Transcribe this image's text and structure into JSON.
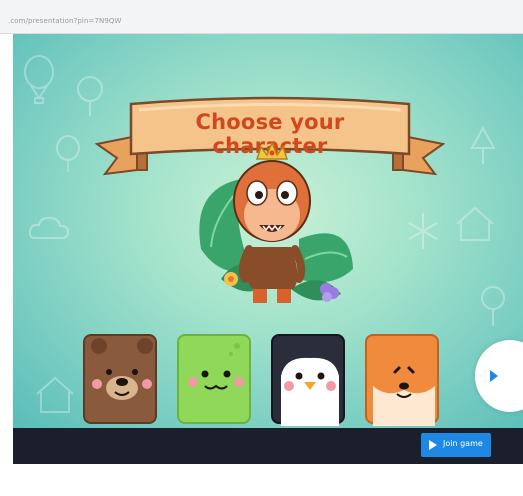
{
  "browser": {
    "url": ".com/presentation?pin=7N9QW"
  },
  "game": {
    "title": "Choose your character",
    "characters": [
      {
        "name": "bear",
        "color": "#8a5a3c"
      },
      {
        "name": "frog",
        "color": "#8fd85a"
      },
      {
        "name": "penguin",
        "color": "#2b2d3a"
      },
      {
        "name": "fox",
        "color": "#f08a3c"
      }
    ],
    "selected_character": "monkey-king",
    "next_icon": "chevron-right-icon"
  },
  "footer": {
    "join_label": "Join game",
    "join_icon": "play-icon",
    "accent": "#1e88e5"
  }
}
